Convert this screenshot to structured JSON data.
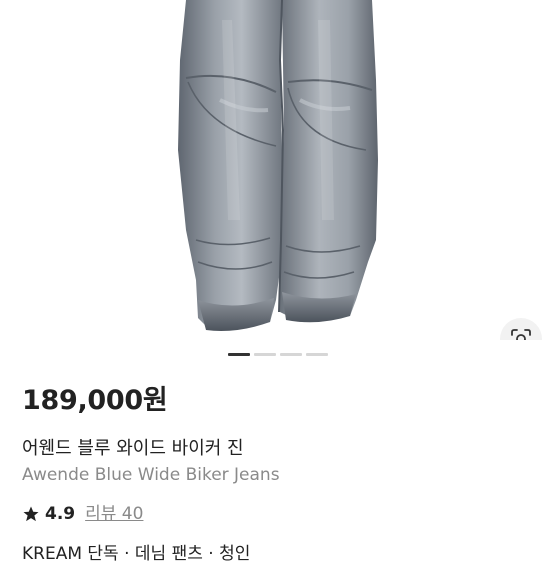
{
  "product": {
    "price": "189,000원",
    "title_ko": "어웬드 블루 와이드 바이커 진",
    "title_en": "Awende Blue Wide Biker Jeans",
    "rating": "4.9",
    "reviews_label": "리뷰 40",
    "tags": "KREAM 단독 · 데님 팬츠 · 청인"
  },
  "gallery": {
    "total_images": 4,
    "current_image": 1
  },
  "icons": {
    "lens": "visual-search-icon",
    "star": "star-icon"
  },
  "colors": {
    "text": "#222222",
    "muted": "#8a8a8a",
    "pager_active": "#333333",
    "pager_inactive": "#d6d6d6"
  }
}
